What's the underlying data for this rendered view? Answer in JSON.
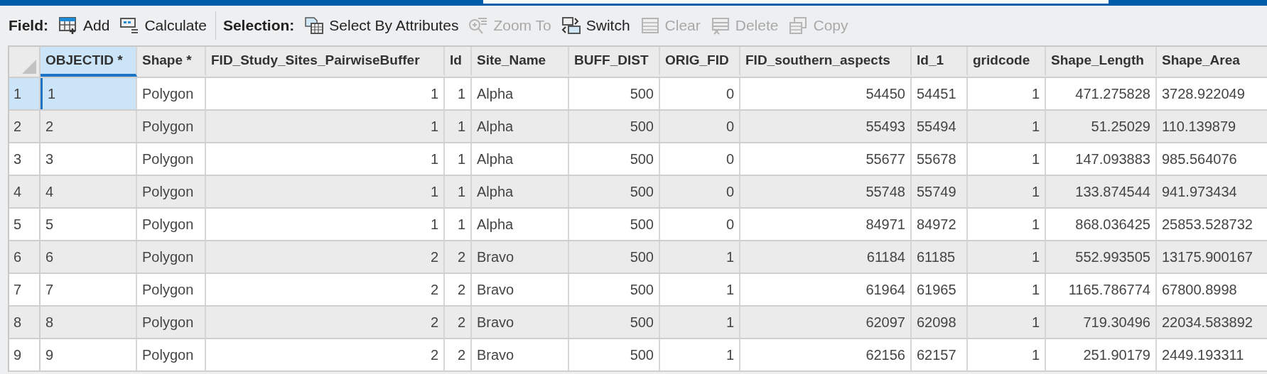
{
  "toolbar": {
    "groups": [
      {
        "label": "Field:",
        "buttons": [
          {
            "kind": "add",
            "label": "Add",
            "disabled": false
          },
          {
            "kind": "calculate",
            "label": "Calculate",
            "disabled": false
          }
        ]
      },
      {
        "label": "Selection:",
        "buttons": [
          {
            "kind": "select",
            "label": "Select By Attributes",
            "disabled": false
          },
          {
            "kind": "zoom",
            "label": "Zoom To",
            "disabled": true
          },
          {
            "kind": "switch",
            "label": "Switch",
            "disabled": false
          },
          {
            "kind": "clear",
            "label": "Clear",
            "disabled": true
          },
          {
            "kind": "delete",
            "label": "Delete",
            "disabled": true
          },
          {
            "kind": "copy",
            "label": "Copy",
            "disabled": true
          }
        ]
      }
    ]
  },
  "table": {
    "columns": [
      {
        "label": "OBJECTID *",
        "kind": "text",
        "selected": true
      },
      {
        "label": "Shape *",
        "kind": "text",
        "selected": false
      },
      {
        "label": "FID_Study_Sites_PairwiseBuffer",
        "kind": "number",
        "selected": false
      },
      {
        "label": "Id",
        "kind": "number",
        "selected": false
      },
      {
        "label": "Site_Name",
        "kind": "text",
        "selected": false
      },
      {
        "label": "BUFF_DIST",
        "kind": "number",
        "selected": false
      },
      {
        "label": "ORIG_FID",
        "kind": "number",
        "selected": false
      },
      {
        "label": "FID_southern_aspects",
        "kind": "number",
        "selected": false
      },
      {
        "label": "Id_1",
        "kind": "text",
        "selected": false
      },
      {
        "label": "gridcode",
        "kind": "number",
        "selected": false
      },
      {
        "label": "Shape_Length",
        "kind": "number",
        "selected": false
      },
      {
        "label": "Shape_Area",
        "kind": "text",
        "selected": false
      }
    ],
    "rows": [
      {
        "number": "1",
        "selected": true,
        "cells": [
          "1",
          "Polygon",
          "1",
          "1",
          "Alpha",
          "500",
          "0",
          "54450",
          "54451",
          "1",
          "471.275828",
          "3728.922049"
        ]
      },
      {
        "number": "2",
        "selected": false,
        "cells": [
          "2",
          "Polygon",
          "1",
          "1",
          "Alpha",
          "500",
          "0",
          "55493",
          "55494",
          "1",
          "51.25029",
          "110.139879"
        ]
      },
      {
        "number": "3",
        "selected": false,
        "cells": [
          "3",
          "Polygon",
          "1",
          "1",
          "Alpha",
          "500",
          "0",
          "55677",
          "55678",
          "1",
          "147.093883",
          "985.564076"
        ]
      },
      {
        "number": "4",
        "selected": false,
        "cells": [
          "4",
          "Polygon",
          "1",
          "1",
          "Alpha",
          "500",
          "0",
          "55748",
          "55749",
          "1",
          "133.874544",
          "941.973434"
        ]
      },
      {
        "number": "5",
        "selected": false,
        "cells": [
          "5",
          "Polygon",
          "1",
          "1",
          "Alpha",
          "500",
          "0",
          "84971",
          "84972",
          "1",
          "868.036425",
          "25853.528732"
        ]
      },
      {
        "number": "6",
        "selected": false,
        "cells": [
          "6",
          "Polygon",
          "2",
          "2",
          "Bravo",
          "500",
          "1",
          "61184",
          "61185",
          "1",
          "552.993505",
          "13175.900167"
        ]
      },
      {
        "number": "7",
        "selected": false,
        "cells": [
          "7",
          "Polygon",
          "2",
          "2",
          "Bravo",
          "500",
          "1",
          "61964",
          "61965",
          "1",
          "1165.786774",
          "67800.8998"
        ]
      },
      {
        "number": "8",
        "selected": false,
        "cells": [
          "8",
          "Polygon",
          "2",
          "2",
          "Bravo",
          "500",
          "1",
          "62097",
          "62098",
          "1",
          "719.30496",
          "22034.583892"
        ]
      },
      {
        "number": "9",
        "selected": false,
        "cells": [
          "9",
          "Polygon",
          "2",
          "2",
          "Bravo",
          "500",
          "1",
          "62156",
          "62157",
          "1",
          "251.90179",
          "2449.193311"
        ]
      }
    ]
  }
}
